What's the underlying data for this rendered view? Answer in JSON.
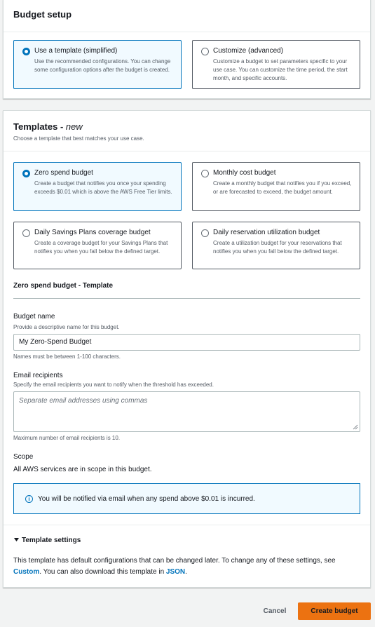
{
  "budget_setup": {
    "title": "Budget setup",
    "options": [
      {
        "label": "Use a template (simplified)",
        "description": "Use the recommended configurations. You can change some configuration options after the budget is created.",
        "selected": true
      },
      {
        "label": "Customize (advanced)",
        "description": "Customize a budget to set parameters specific to your use case. You can customize the time period, the start month, and specific accounts.",
        "selected": false
      }
    ]
  },
  "templates": {
    "title": "Templates - ",
    "title_badge": "new",
    "subtitle": "Choose a template that best matches your use case.",
    "options": [
      {
        "label": "Zero spend budget",
        "description": "Create a budget that notifies you once your spending exceeds $0.01 which is above the AWS Free Tier limits.",
        "selected": true
      },
      {
        "label": "Monthly cost budget",
        "description": "Create a monthly budget that notifies you if you exceed, or are forecasted to exceed, the budget amount.",
        "selected": false
      },
      {
        "label": "Daily Savings Plans coverage budget",
        "description": "Create a coverage budget for your Savings Plans that notifies you when you fall below the defined target.",
        "selected": false
      },
      {
        "label": "Daily reservation utilization budget",
        "description": "Create a utilization budget for your reservations that notifies you when you fall below the defined target.",
        "selected": false
      }
    ]
  },
  "template_form": {
    "heading": "Zero spend budget - Template",
    "budget_name": {
      "label": "Budget name",
      "description": "Provide a descriptive name for this budget.",
      "value": "My Zero-Spend Budget",
      "hint": "Names must be between 1-100 characters."
    },
    "email": {
      "label": "Email recipients",
      "description": "Specify the email recipients you want to notify when the threshold has exceeded.",
      "placeholder": "Separate email addresses using commas",
      "hint": "Maximum number of email recipients is 10."
    },
    "scope": {
      "label": "Scope",
      "value": "All AWS services are in scope in this budget."
    },
    "info_alert": "You will be notified via email when any spend above $0.01 is incurred."
  },
  "template_settings": {
    "toggle_label": "Template settings",
    "text_before": "This template has default configurations that can be changed later. To change any of these settings, see ",
    "custom_link": "Custom",
    "text_middle": ". You can also download this template in ",
    "json_link": "JSON",
    "text_after": "."
  },
  "actions": {
    "cancel": "Cancel",
    "create": "Create budget"
  },
  "colors": {
    "accent": "#0073bb",
    "primary_button": "#ec7211"
  },
  "icons": [
    "info-icon",
    "caret-down-icon",
    "resize-handle-icon"
  ]
}
